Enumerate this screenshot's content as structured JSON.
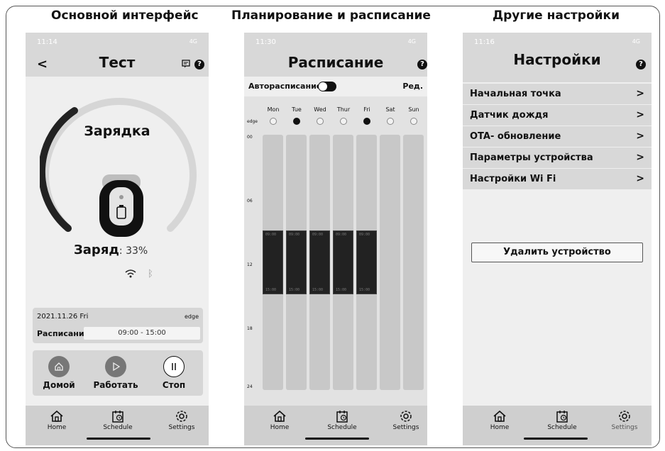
{
  "titles": {
    "main": "Основной интерфейс",
    "schedule": "Планирование и расписание",
    "settings": "Другие настройки"
  },
  "status": {
    "p1_time": "11:14",
    "p2_time": "11:30",
    "p3_time": "11:16",
    "signal": "4G"
  },
  "main_screen": {
    "title": "Тест",
    "charging_label": "Зарядка",
    "charge_label": "Заряд",
    "charge_value": ": 33%",
    "date": "2021.11.26 Fri",
    "mode": "edge",
    "schedule_label": "Расписание",
    "schedule_time": "09:00 - 15:00",
    "actions": {
      "home": "Домой",
      "work": "Работать",
      "stop": "Стоп"
    }
  },
  "schedule_screen": {
    "title": "Расписание",
    "auto_label": "Авторасписание",
    "auto_enabled": true,
    "edit_label": "Ред.",
    "edge_label": "edge",
    "days": [
      "Mon",
      "Tue",
      "Wed",
      "Thur",
      "Fri",
      "Sat",
      "Sun"
    ],
    "edge_selected": [
      false,
      true,
      false,
      false,
      true,
      false,
      false
    ],
    "hours": [
      "00",
      "06",
      "12",
      "18",
      "24"
    ],
    "slots": [
      {
        "day": "Mon",
        "start": "09:00",
        "end": "15:00"
      },
      {
        "day": "Tue",
        "start": "09:00",
        "end": "15:00"
      },
      {
        "day": "Wed",
        "start": "09:00",
        "end": "15:00"
      },
      {
        "day": "Thur",
        "start": "09:00",
        "end": "15:00"
      },
      {
        "day": "Fri",
        "start": "09:00",
        "end": "15:00"
      }
    ]
  },
  "settings_screen": {
    "title": "Настройки",
    "items": [
      "Начальная точка",
      "Датчик дождя",
      "OTA- обновление",
      "Параметры устройства",
      "Настройки Wi Fi"
    ],
    "delete_label": "Удалить устройство"
  },
  "nav": {
    "home": "Home",
    "schedule": "Schedule",
    "settings": "Settings"
  }
}
